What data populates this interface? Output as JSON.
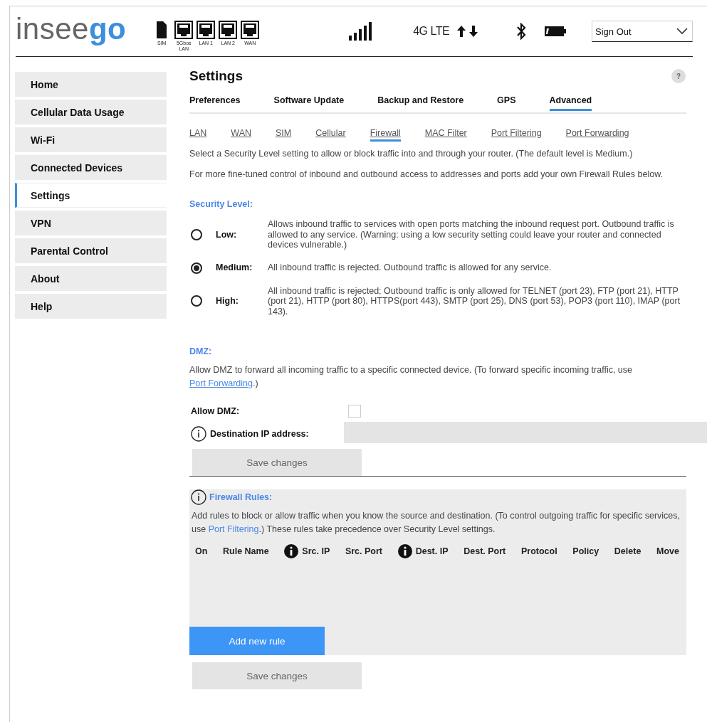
{
  "header": {
    "logo": {
      "text": "insee",
      "accent": "go"
    },
    "ports": [
      {
        "label": "SIM",
        "kind": "sim"
      },
      {
        "label": "5Gbos LAN",
        "kind": "ethernet"
      },
      {
        "label": "LAN 1",
        "kind": "ethernet"
      },
      {
        "label": "LAN 2",
        "kind": "ethernet"
      },
      {
        "label": "WAN",
        "kind": "ethernet"
      }
    ],
    "network": "4G LTE",
    "account_menu": "Sign Out"
  },
  "sidebar": {
    "items": [
      {
        "label": "Home",
        "selected": false
      },
      {
        "label": "Cellular Data Usage",
        "selected": false
      },
      {
        "label": "Wi-Fi",
        "selected": false
      },
      {
        "label": "Connected Devices",
        "selected": false
      },
      {
        "label": "Settings",
        "selected": true
      },
      {
        "label": "VPN",
        "selected": false
      },
      {
        "label": "Parental Control",
        "selected": false
      },
      {
        "label": "About",
        "selected": false
      },
      {
        "label": "Help",
        "selected": false
      }
    ]
  },
  "page": {
    "title": "Settings",
    "help": "?"
  },
  "tabs": [
    {
      "label": "Preferences",
      "selected": false
    },
    {
      "label": "Software Update",
      "selected": false
    },
    {
      "label": "Backup and Restore",
      "selected": false
    },
    {
      "label": "GPS",
      "selected": false
    },
    {
      "label": "Advanced",
      "selected": true
    }
  ],
  "subtabs": [
    {
      "label": "LAN",
      "selected": false
    },
    {
      "label": "WAN",
      "selected": false
    },
    {
      "label": "SIM",
      "selected": false
    },
    {
      "label": "Cellular",
      "selected": false
    },
    {
      "label": "Firewall",
      "selected": true
    },
    {
      "label": "MAC Filter",
      "selected": false
    },
    {
      "label": "Port Filtering",
      "selected": false
    },
    {
      "label": "Port Forwarding",
      "selected": false
    }
  ],
  "intro": [
    "Select a Security Level setting to allow or block traffic into and through your router. (The default level is Medium.)",
    "For more fine-tuned control of inbound and outbound access to addresses and ports add your own Firewall Rules below."
  ],
  "security": {
    "heading": "Security Level:",
    "levels": [
      {
        "label": "Low:",
        "description": "Allows inbound traffic to services with open ports matching the inbound request port. Outbound traffic is allowed to any service. (Warning: using a low security setting could leave your router and connected devices vulnerable.)",
        "selected": false
      },
      {
        "label": "Medium:",
        "description": "All inbound traffic is rejected. Outbound traffic is allowed for any service.",
        "selected": true
      },
      {
        "label": "High:",
        "description": "All inbound traffic is rejected; Outbound traffic is only allowed for TELNET (port 23), FTP (port 21), HTTP (port 21), HTTP (port 80), HTTPS(port 443), SMTP (port 25), DNS (port 53), POP3 (port 110), IMAP (port 143).",
        "selected": false
      }
    ]
  },
  "dmz": {
    "heading": "DMZ:",
    "description_before": "Allow DMZ to forward all incoming traffic to a specific connected device. (To forward specific incoming traffic, use ",
    "link": "Port Forwarding",
    "description_after": ".)",
    "allow_label": "Allow DMZ:",
    "allow_checked": false,
    "destination_label": "Destination IP address:",
    "save": "Save changes"
  },
  "firewall_rules": {
    "heading": "Firewall Rules:",
    "description_before": "Add rules to block or allow traffic when you know the source and destination. (To control outgoing traffic for specific services, use ",
    "link": "Port Filtering",
    "description_after": ".) These rules take precedence over Security Level settings.",
    "columns": [
      {
        "label": "On",
        "info": false
      },
      {
        "label": "Rule Name",
        "info": false
      },
      {
        "label": "Src. IP",
        "info": true
      },
      {
        "label": "Src. Port",
        "info": false
      },
      {
        "label": "Dest. IP",
        "info": true
      },
      {
        "label": "Dest. Port",
        "info": false
      },
      {
        "label": "Protocol",
        "info": false
      },
      {
        "label": "Policy",
        "info": false
      },
      {
        "label": "Delete",
        "info": false
      },
      {
        "label": "Move",
        "info": false
      }
    ],
    "add": "Add new rule",
    "save": "Save changes"
  }
}
